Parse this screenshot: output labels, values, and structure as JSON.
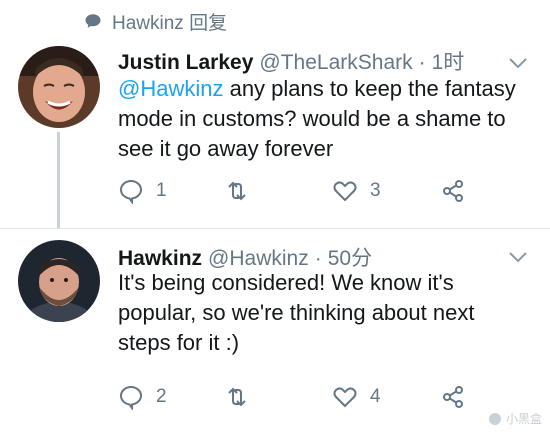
{
  "reply_context": {
    "text": "Hawkinz 回复",
    "icon": "speech-bubble-icon"
  },
  "tweets": [
    {
      "name": "Justin Larkey",
      "handle": "@TheLarkShark",
      "time": "1时",
      "mention": "@Hawkinz",
      "text_lines": [
        " any plans to keep the fantasy",
        "mode in customs? would be a shame to",
        "see it go away forever"
      ],
      "replies": "1",
      "retweets": "",
      "likes": "3"
    },
    {
      "name": "Hawkinz",
      "handle": "@Hawkinz",
      "time": "50分",
      "text_lines": [
        "It's being considered! We know it's",
        "popular, so we're thinking about next",
        "steps for it :)"
      ],
      "replies": "2",
      "retweets": "",
      "likes": "4"
    }
  ],
  "separator": "·",
  "watermark": "小黑盒",
  "colors": {
    "accent": "#1da1f2",
    "muted": "#657786",
    "text": "#14171a",
    "line": "#c8d1d8"
  }
}
